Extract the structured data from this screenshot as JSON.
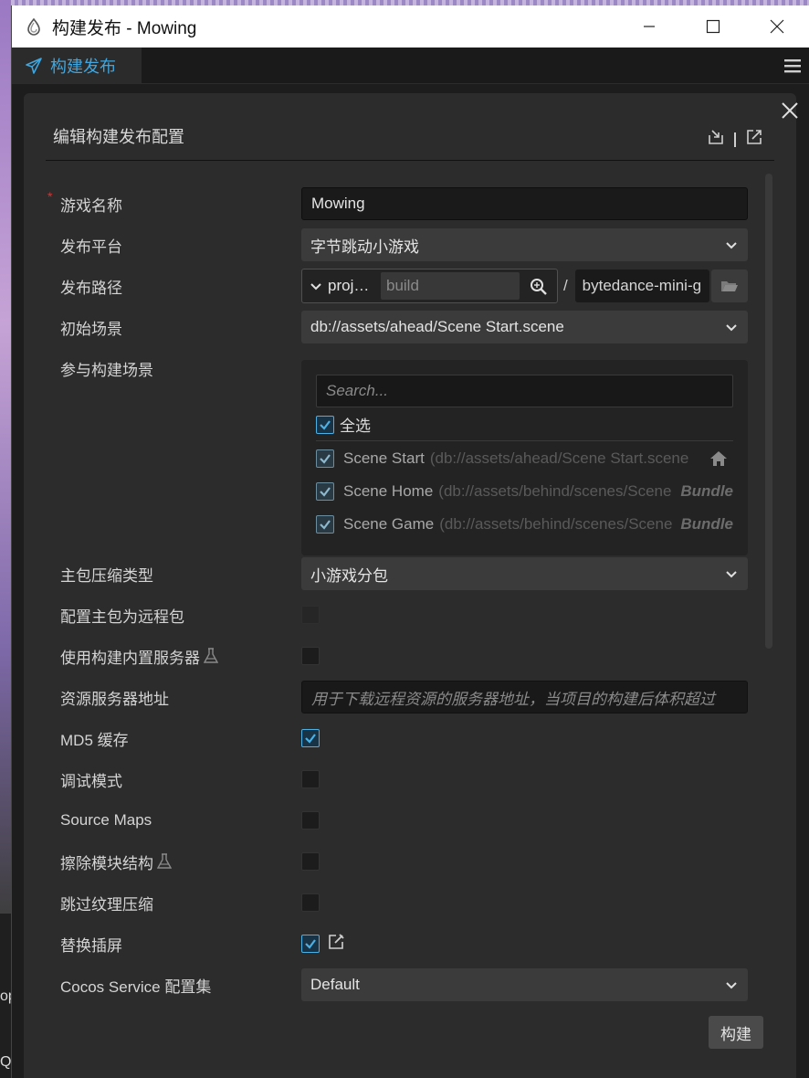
{
  "window": {
    "title": "构建发布 - Mowing"
  },
  "tab": {
    "label": "构建发布"
  },
  "panel": {
    "title": "编辑构建发布配置"
  },
  "form": {
    "game_name": {
      "label": "游戏名称",
      "value": "Mowing",
      "required_mark": "*"
    },
    "platform": {
      "label": "发布平台",
      "value": "字节跳动小游戏"
    },
    "build_path": {
      "label": "发布路径",
      "prefix": "proj…",
      "input_placeholder": "build",
      "separator": "/",
      "folder": "bytedance-mini-g"
    },
    "start_scene": {
      "label": "初始场景",
      "value": "db://assets/ahead/Scene Start.scene"
    },
    "scenes": {
      "label": "参与构建场景",
      "search_placeholder": "Search...",
      "select_all_label": "全选",
      "items": [
        {
          "name": "Scene Start",
          "path": "(db://assets/ahead/Scene Start.scene",
          "tag_icon": "home-icon"
        },
        {
          "name": "Scene Home",
          "path": "(db://assets/behind/scenes/Scene",
          "tag": "Bundle"
        },
        {
          "name": "Scene Game",
          "path": "(db://assets/behind/scenes/Scene",
          "tag": "Bundle"
        }
      ]
    },
    "compress_type": {
      "label": "主包压缩类型",
      "value": "小游戏分包"
    },
    "remote_main": {
      "label": "配置主包为远程包",
      "checked": false
    },
    "builtin_server": {
      "label": "使用构建内置服务器",
      "checked": false
    },
    "server_address": {
      "label": "资源服务器地址",
      "placeholder": "用于下载远程资源的服务器地址，当项目的构建后体积超过"
    },
    "md5_cache": {
      "label": "MD5 缓存",
      "checked": true
    },
    "debug": {
      "label": "调试模式",
      "checked": false
    },
    "source_maps": {
      "label": "Source Maps",
      "checked": false
    },
    "erase_modules": {
      "label": "擦除模块结构",
      "checked": false
    },
    "skip_texture": {
      "label": "跳过纹理压缩",
      "checked": false
    },
    "replace_splash": {
      "label": "替换插屏",
      "checked": true
    },
    "cocos_service": {
      "label": "Cocos Service 配置集",
      "value": "Default"
    }
  },
  "actions": {
    "build_label": "构建"
  },
  "background": {
    "text_a": "op",
    "text_b": "Q"
  },
  "colors": {
    "accent": "#3fa6df",
    "required": "#c23c3c"
  }
}
